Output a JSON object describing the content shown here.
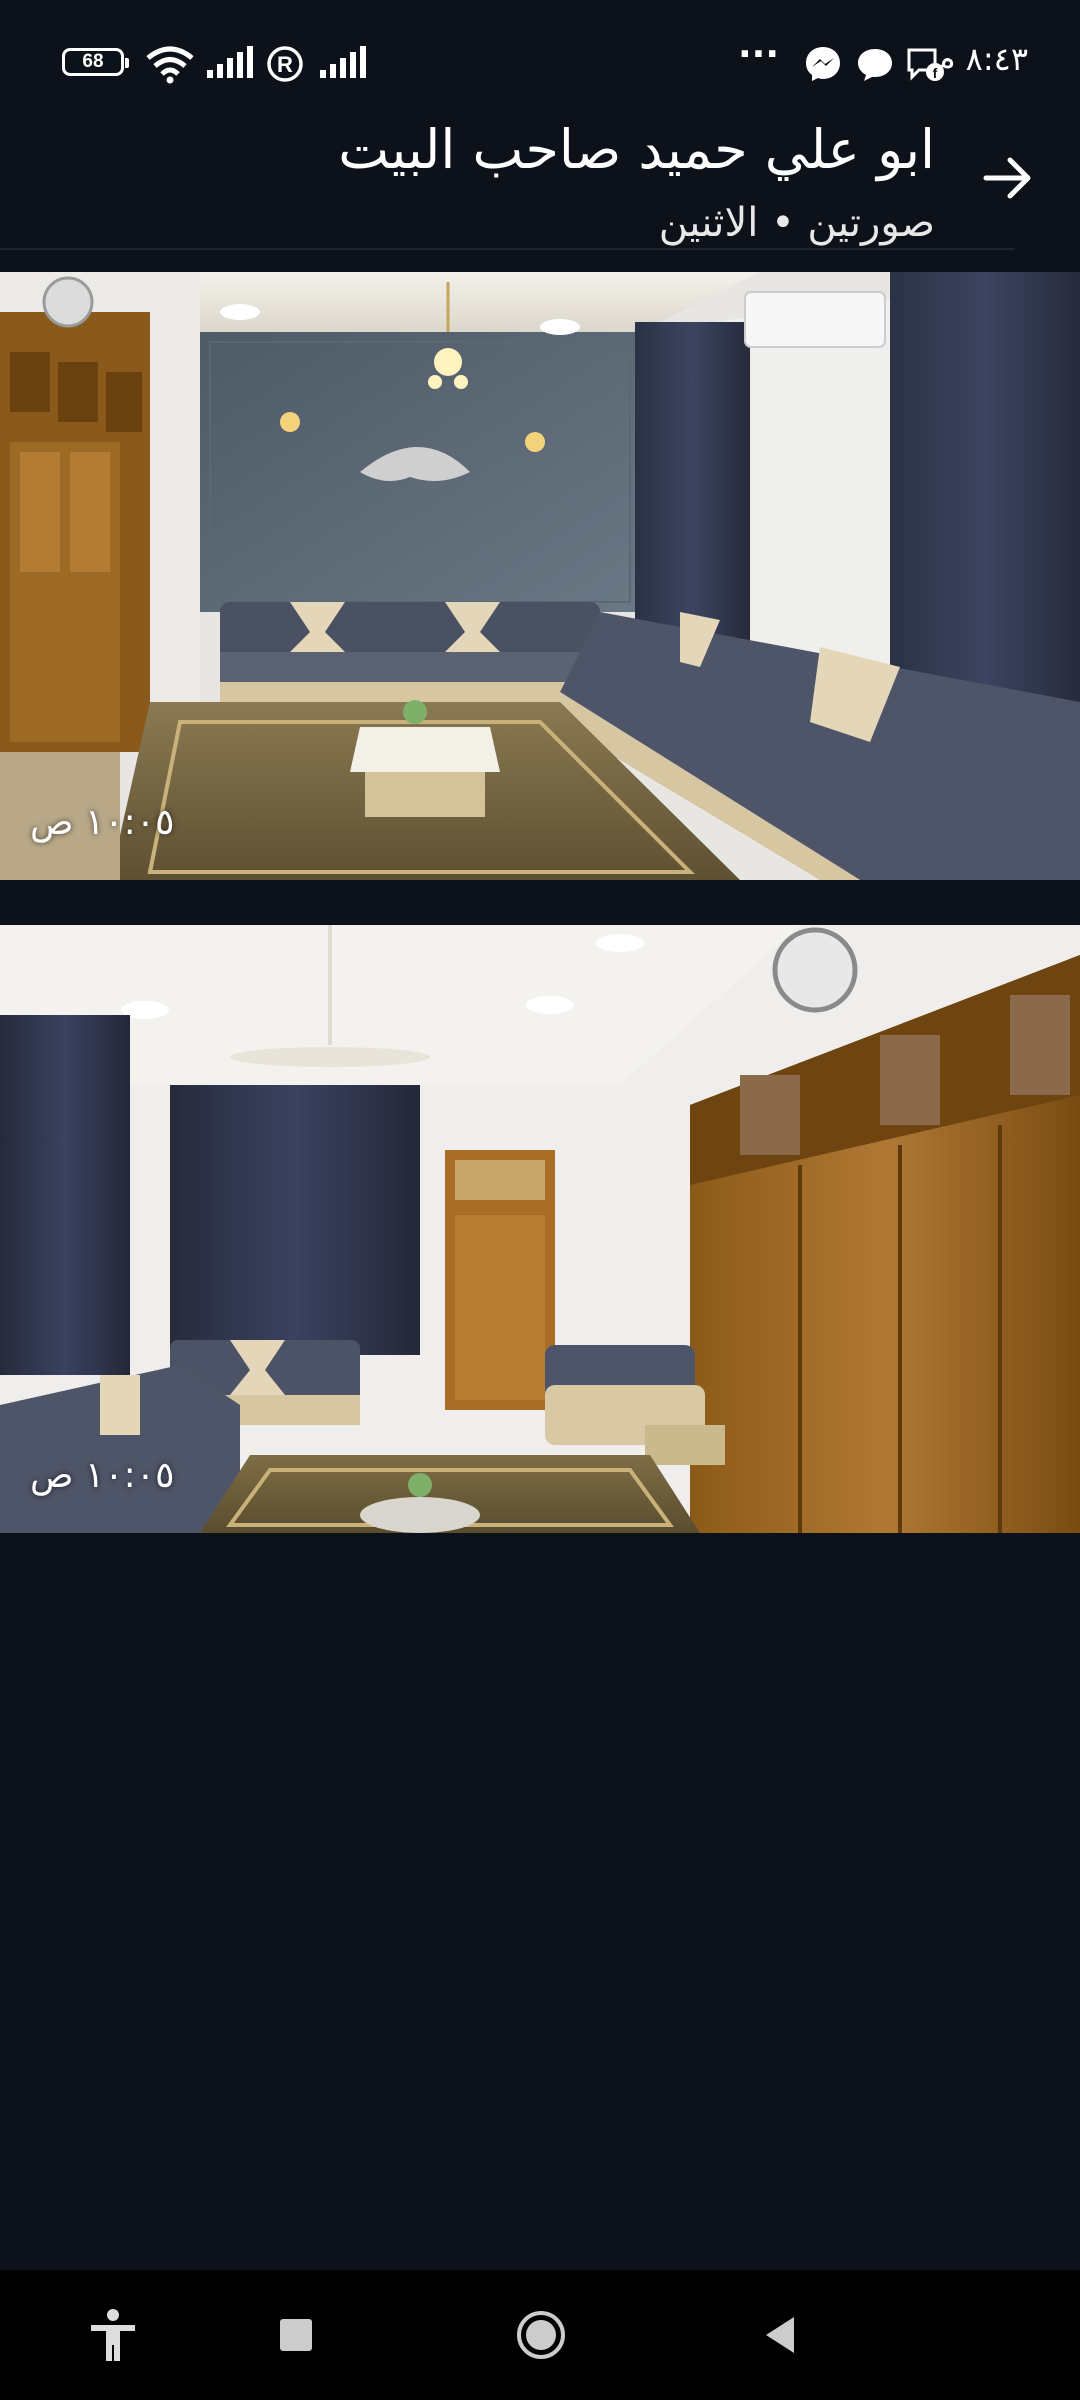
{
  "status_bar": {
    "battery_level": "68",
    "time": "٨:٤٣ م",
    "more_indicator": "···",
    "icons": [
      "battery-icon",
      "wifi-icon",
      "signal-icon",
      "registered-icon",
      "signal-icon",
      "more-icon",
      "messenger-icon",
      "chat-icon",
      "facebook-message-icon"
    ]
  },
  "header": {
    "title": "ابو علي حميد صاحب البيت",
    "subtitle": "صورتين  •  الاثنين",
    "back_icon": "arrow-icon"
  },
  "photos": [
    {
      "timestamp": "١٠:٠٥ ص"
    },
    {
      "timestamp": "١٠:٠٥ ص"
    }
  ],
  "nav_bar": {
    "icons": [
      "accessibility-icon",
      "recents-icon",
      "home-icon",
      "back-icon"
    ]
  },
  "colors": {
    "background": "#0d111a",
    "nav_background": "#000000",
    "text": "#ffffff"
  }
}
